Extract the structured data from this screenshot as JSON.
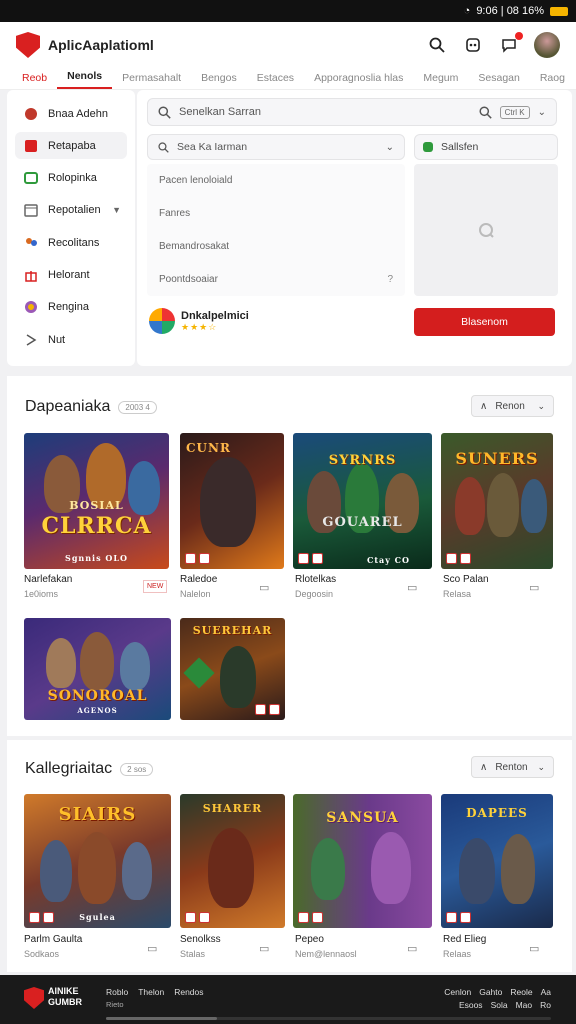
{
  "status_bar": {
    "text": "9:06 | 08 16%"
  },
  "app": {
    "title": "AplicAaplatioml"
  },
  "tabs": [
    {
      "label": "Reob"
    },
    {
      "label": "Nenols"
    },
    {
      "label": "Permasahalt"
    },
    {
      "label": "Bengos"
    },
    {
      "label": "Estaces"
    },
    {
      "label": "Apporagnoslia hlas"
    },
    {
      "label": "Megum"
    },
    {
      "label": "Sesagan"
    },
    {
      "label": "Raog"
    }
  ],
  "sidebar": {
    "items": [
      {
        "label": "Bnaa Adehn",
        "icon": "compass-icon",
        "color": "#c0392b"
      },
      {
        "label": "Retapaba",
        "icon": "tag-icon",
        "color": "#d92020"
      },
      {
        "label": "Rolopinka",
        "icon": "gamepad-icon",
        "color": "#2f9a3c"
      },
      {
        "label": "Repotalien",
        "icon": "calendar-icon",
        "color": "#666666"
      },
      {
        "label": "Recolitans",
        "icon": "people-icon",
        "color": "#d96a20"
      },
      {
        "label": "Helorant",
        "icon": "gift-icon",
        "color": "#d92020"
      },
      {
        "label": "Rengina",
        "icon": "chat-icon",
        "color": "#9b59b6"
      },
      {
        "label": "Nut",
        "icon": "arrow-icon",
        "color": "#555555"
      }
    ]
  },
  "search": {
    "placeholder": "Senelkan Sarran",
    "kbd": "Ctrl K"
  },
  "filter": {
    "dropdown_label": "Sea Ka Iarman",
    "options": [
      "Pacen lenoloiald",
      "Fanres",
      "Bemandrosakat",
      "Poontdsoaiar"
    ],
    "tag_label": "Sallsfen"
  },
  "product": {
    "name": "Dnkalpelmici",
    "rating": "★★★☆"
  },
  "cta": {
    "label": "Blasenom"
  },
  "section1": {
    "title": "Dapeaniaka",
    "badge": "2003 4",
    "sort_label": "Renon",
    "cards": [
      {
        "art_title": "CLRRCA",
        "art_sub": "BOSIAL",
        "band": "Sgnnis OLO",
        "caption": "Narlefakan",
        "sub": "1e0ioms",
        "hot": "NEW"
      },
      {
        "art_title": "CUNR",
        "art_sub": "",
        "band": "",
        "caption": "Raledoe",
        "sub": "Nalelon",
        "hot": ""
      },
      {
        "art_title": "SYRNRS",
        "art_sub": "GOUAREL",
        "band": "Ctay CO",
        "caption": "Rlotelkas",
        "sub": "Degoosin",
        "hot": ""
      },
      {
        "art_title": "SUNERS",
        "art_sub": "",
        "band": "",
        "caption": "Sco Palan",
        "sub": "Relasa",
        "hot": ""
      },
      {
        "art_title": "SONOROAL",
        "art_sub": "AGENOS",
        "band": "",
        "caption": "",
        "sub": "",
        "hot": ""
      },
      {
        "art_title": "SUEREHAR",
        "art_sub": "",
        "band": "",
        "caption": "",
        "sub": "",
        "hot": ""
      }
    ]
  },
  "section2": {
    "title": "Kallegriaitac",
    "badge": "2 sos",
    "sort_label": "Renton",
    "cards": [
      {
        "art_title": "SIAIRS",
        "art_sub": "",
        "band": "Sgulea",
        "caption": "Parlm Gaulta",
        "sub": "Sodkaos",
        "hot": ""
      },
      {
        "art_title": "SHARER",
        "art_sub": "",
        "band": "",
        "caption": "Senolkss",
        "sub": "Stalas",
        "hot": ""
      },
      {
        "art_title": "SANSUA",
        "art_sub": "",
        "band": "",
        "caption": "Pepeo",
        "sub": "Nem@lennaosl",
        "hot": ""
      },
      {
        "art_title": "DAPEES",
        "art_sub": "",
        "band": "",
        "caption": "Red Elieg",
        "sub": "Relaas",
        "hot": ""
      }
    ]
  },
  "footer": {
    "brand_line1": "AlNIKE",
    "brand_line2": "GUMBR",
    "links": [
      "Roblo",
      "Thelon",
      "Rendos"
    ],
    "copyright": "Rieto",
    "right_links_1": [
      "Cenlon",
      "Gahto",
      "Reole",
      "Aa"
    ],
    "right_links_2": [
      "Esoos",
      "Sola",
      "Mao",
      "Ro"
    ]
  },
  "colors": {
    "accent": "#d92020",
    "cta": "#d41e1e",
    "footer_bg": "#1a1a1a"
  }
}
